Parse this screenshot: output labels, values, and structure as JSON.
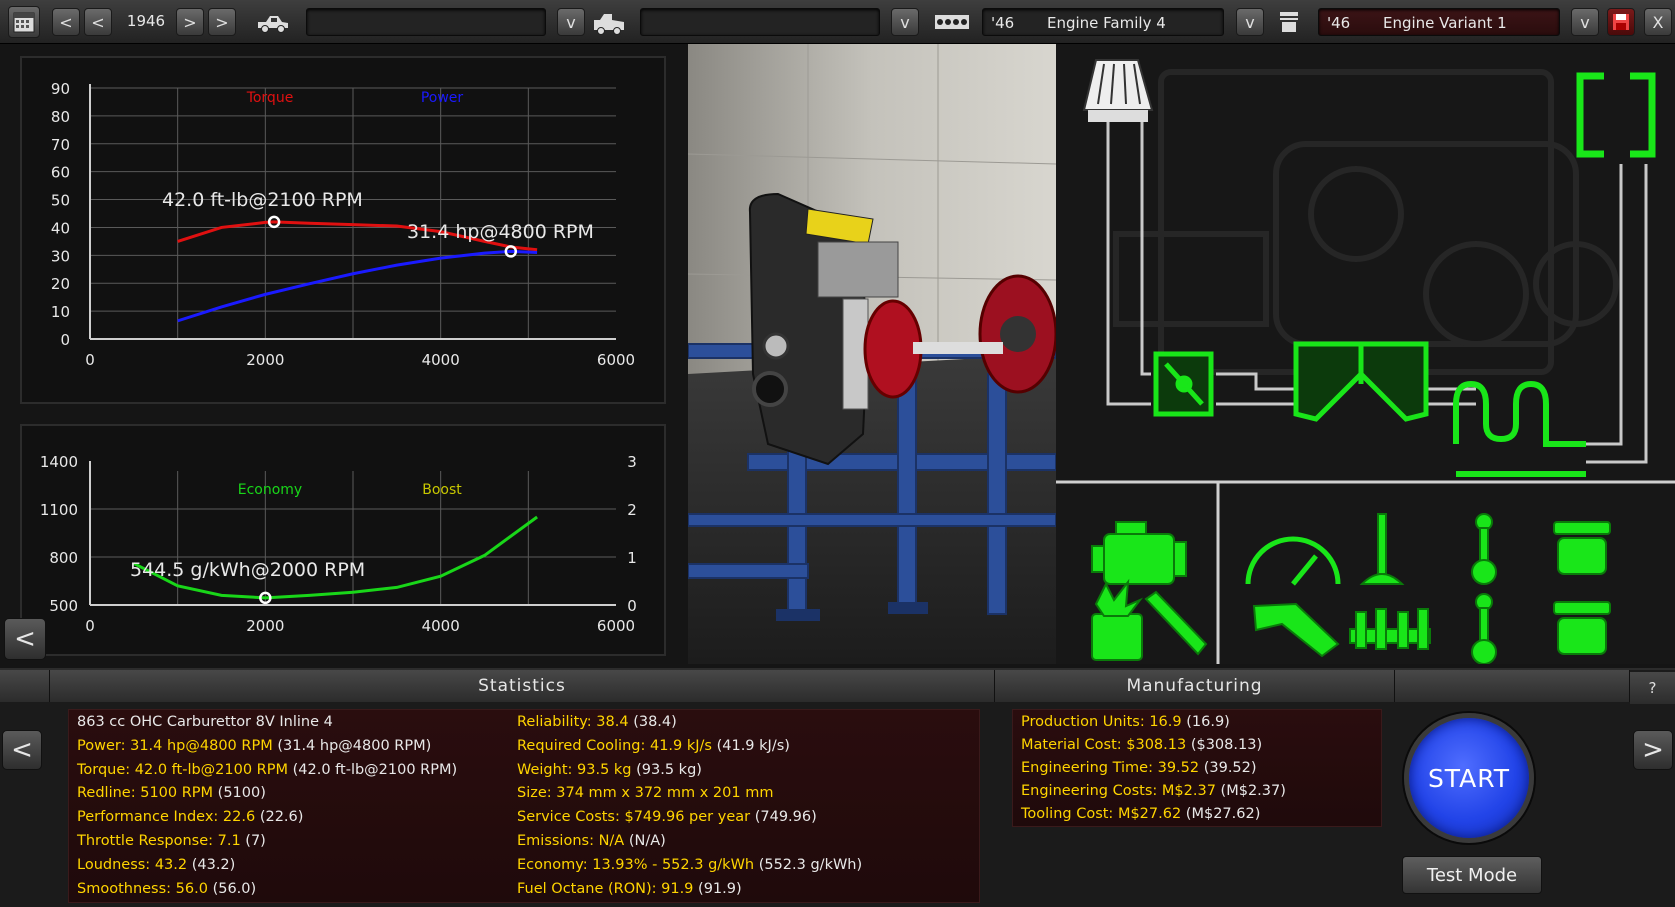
{
  "toolbar": {
    "year": "1946",
    "year_prev_fast": "<",
    "year_prev": "<",
    "year_next": ">",
    "year_next_fast": ">",
    "dropdown_symbol": "v",
    "engine_family_year": "'46",
    "engine_family": "Engine Family 4",
    "engine_variant_year": "'46",
    "engine_variant": "Engine Variant 1",
    "close": "X"
  },
  "graph_top": {
    "legend": [
      "Torque",
      "Power"
    ],
    "y_ticks": [
      "90",
      "80",
      "70",
      "60",
      "50",
      "40",
      "30",
      "20",
      "10",
      "0"
    ],
    "x_ticks": [
      "0",
      "2000",
      "4000",
      "6000"
    ],
    "torque_label": "42.0 ft-lb@2100 RPM",
    "power_label": "31.4 hp@4800 RPM"
  },
  "graph_bottom": {
    "legend": [
      "Economy",
      "Boost"
    ],
    "y_left_ticks": [
      "1400",
      "1100",
      "800",
      "500"
    ],
    "y_right_ticks": [
      "3",
      "2",
      "1",
      "0"
    ],
    "x_ticks": [
      "0",
      "2000",
      "4000",
      "6000"
    ],
    "economy_label": "544.5 g/kWh@2000 RPM"
  },
  "chart_data": [
    {
      "type": "line",
      "title": "",
      "xlabel": "",
      "ylabel": "",
      "xlim": [
        0,
        6000
      ],
      "ylim": [
        0,
        90
      ],
      "grid": true,
      "legend_position": "top-center",
      "series": [
        {
          "name": "Torque",
          "color": "#e01010",
          "x": [
            1000,
            1500,
            2000,
            2100,
            2500,
            3000,
            3500,
            4000,
            4500,
            4800,
            5100
          ],
          "y": [
            35,
            40,
            41.8,
            42.0,
            41.5,
            41.0,
            40.5,
            38.5,
            35.0,
            33.0,
            32.0
          ]
        },
        {
          "name": "Power",
          "color": "#1a1aff",
          "x": [
            1000,
            1500,
            2000,
            2500,
            3000,
            3500,
            4000,
            4500,
            4800,
            5100
          ],
          "y": [
            6.5,
            11.5,
            16,
            19.8,
            23.4,
            26.5,
            29,
            30.8,
            31.4,
            31.0
          ]
        }
      ],
      "annotations": [
        {
          "text": "42.0 ft-lb@2100 RPM",
          "x": 2100,
          "y": 42.0
        },
        {
          "text": "31.4 hp@4800 RPM",
          "x": 4800,
          "y": 31.4
        }
      ]
    },
    {
      "type": "line",
      "title": "",
      "xlabel": "",
      "ylabel": "",
      "xlim": [
        0,
        6000
      ],
      "ylim": [
        500,
        1400
      ],
      "y2lim": [
        0,
        3
      ],
      "grid": true,
      "legend_position": "top-center",
      "series": [
        {
          "name": "Economy",
          "color": "#19d619",
          "x": [
            500,
            1000,
            1500,
            2000,
            2500,
            3000,
            3500,
            4000,
            4500,
            5100
          ],
          "y": [
            760,
            620,
            560,
            544.5,
            560,
            580,
            610,
            680,
            810,
            1050
          ]
        },
        {
          "name": "Boost",
          "color": "#c8c800",
          "x": [],
          "y": []
        }
      ],
      "annotations": [
        {
          "text": "544.5 g/kWh@2000 RPM",
          "x": 2000,
          "y": 544.5
        }
      ]
    }
  ],
  "statistics": {
    "header": "Statistics",
    "left": [
      {
        "label": "",
        "value": "863 cc OHC Carburettor 8V Inline 4"
      },
      {
        "label": "Power:",
        "value": "31.4 hp@4800 RPM (31.4 hp@4800 RPM)"
      },
      {
        "label": "Torque:",
        "value": "42.0 ft-lb@2100 RPM (42.0 ft-lb@2100 RPM)"
      },
      {
        "label": "Redline:",
        "value": "5100 RPM (5100)"
      },
      {
        "label": "Performance Index:",
        "value": "22.6 (22.6)"
      },
      {
        "label": "Throttle Response:",
        "value": "7.1 (7)"
      },
      {
        "label": "Loudness:",
        "value": "43.2 (43.2)"
      },
      {
        "label": "Smoothness:",
        "value": "56.0 (56.0)"
      }
    ],
    "right": [
      {
        "label": "Reliability:",
        "value": "38.4 (38.4)"
      },
      {
        "label": "Required Cooling:",
        "value": "41.9 kJ/s (41.9 kJ/s)"
      },
      {
        "label": "Weight:",
        "value": "93.5 kg (93.5 kg)"
      },
      {
        "label": "Size:",
        "value": "374 mm x 372 mm x 201 mm"
      },
      {
        "label": "Service Costs:",
        "value": "$749.96 per year (749.96)"
      },
      {
        "label": "Emissions:",
        "value": "N/A (N/A)"
      },
      {
        "label": "Economy:",
        "value": "13.93% - 552.3 g/kWh (552.3 g/kWh)"
      },
      {
        "label": "Fuel Octane (RON):",
        "value": "91.9 (91.9)"
      }
    ]
  },
  "manufacturing": {
    "header": "Manufacturing",
    "rows": [
      {
        "label": "Production Units:",
        "value": "16.9 (16.9)"
      },
      {
        "label": "Material Cost:",
        "value": "$308.13 ($308.13)"
      },
      {
        "label": "Engineering Time:",
        "value": "39.52 (39.52)"
      },
      {
        "label": "Engineering Costs:",
        "value": "M$2.37 (M$2.37)"
      },
      {
        "label": "Tooling Cost:",
        "value": "M$27.62 (M$27.62)"
      }
    ]
  },
  "actions": {
    "start": "START",
    "test_mode": "Test Mode",
    "help": "?",
    "back": "<",
    "left": "<",
    "right": ">"
  },
  "colors": {
    "accent_green": "#19e619",
    "torque": "#e01010",
    "power": "#1a1aff",
    "stat_label": "#ffd400",
    "start_blue": "#2244e8"
  },
  "icons": [
    "calendar-icon",
    "car-icon",
    "truck-icon",
    "engine-block-icon",
    "piston-icon",
    "save-icon",
    "air-filter-icon",
    "exhaust-icon",
    "throttle-icon",
    "intake-manifold-icon",
    "headers-icon",
    "engine-icon",
    "gauge-icon",
    "valve-icon",
    "conrod-icon",
    "piston-part-icon",
    "ignition-icon",
    "injector-icon",
    "tools-icon",
    "camshaft-icon"
  ]
}
